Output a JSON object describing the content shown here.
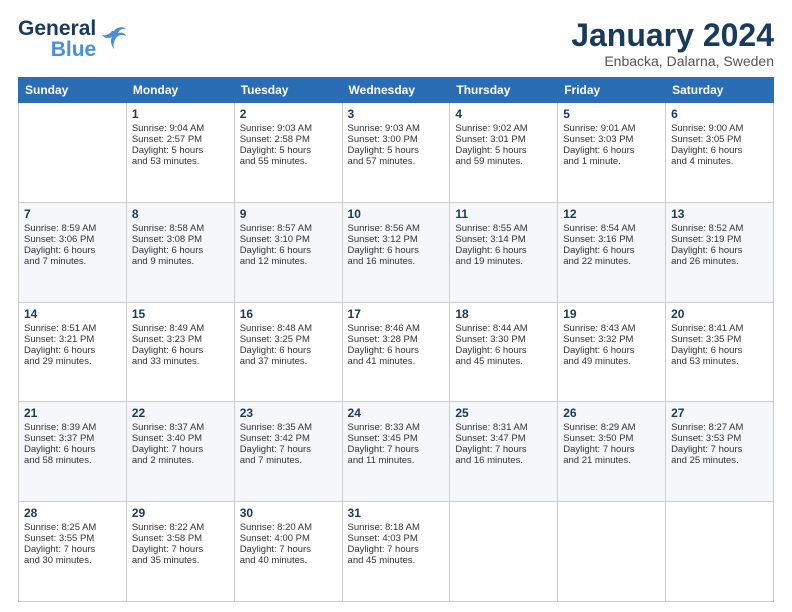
{
  "header": {
    "logo_line1": "General",
    "logo_line2": "Blue",
    "title": "January 2024",
    "subtitle": "Enbacka, Dalarna, Sweden"
  },
  "days_of_week": [
    "Sunday",
    "Monday",
    "Tuesday",
    "Wednesday",
    "Thursday",
    "Friday",
    "Saturday"
  ],
  "weeks": [
    [
      {
        "day": "",
        "info": ""
      },
      {
        "day": "1",
        "info": "Sunrise: 9:04 AM\nSunset: 2:57 PM\nDaylight: 5 hours\nand 53 minutes."
      },
      {
        "day": "2",
        "info": "Sunrise: 9:03 AM\nSunset: 2:58 PM\nDaylight: 5 hours\nand 55 minutes."
      },
      {
        "day": "3",
        "info": "Sunrise: 9:03 AM\nSunset: 3:00 PM\nDaylight: 5 hours\nand 57 minutes."
      },
      {
        "day": "4",
        "info": "Sunrise: 9:02 AM\nSunset: 3:01 PM\nDaylight: 5 hours\nand 59 minutes."
      },
      {
        "day": "5",
        "info": "Sunrise: 9:01 AM\nSunset: 3:03 PM\nDaylight: 6 hours\nand 1 minute."
      },
      {
        "day": "6",
        "info": "Sunrise: 9:00 AM\nSunset: 3:05 PM\nDaylight: 6 hours\nand 4 minutes."
      }
    ],
    [
      {
        "day": "7",
        "info": "Sunrise: 8:59 AM\nSunset: 3:06 PM\nDaylight: 6 hours\nand 7 minutes."
      },
      {
        "day": "8",
        "info": "Sunrise: 8:58 AM\nSunset: 3:08 PM\nDaylight: 6 hours\nand 9 minutes."
      },
      {
        "day": "9",
        "info": "Sunrise: 8:57 AM\nSunset: 3:10 PM\nDaylight: 6 hours\nand 12 minutes."
      },
      {
        "day": "10",
        "info": "Sunrise: 8:56 AM\nSunset: 3:12 PM\nDaylight: 6 hours\nand 16 minutes."
      },
      {
        "day": "11",
        "info": "Sunrise: 8:55 AM\nSunset: 3:14 PM\nDaylight: 6 hours\nand 19 minutes."
      },
      {
        "day": "12",
        "info": "Sunrise: 8:54 AM\nSunset: 3:16 PM\nDaylight: 6 hours\nand 22 minutes."
      },
      {
        "day": "13",
        "info": "Sunrise: 8:52 AM\nSunset: 3:19 PM\nDaylight: 6 hours\nand 26 minutes."
      }
    ],
    [
      {
        "day": "14",
        "info": "Sunrise: 8:51 AM\nSunset: 3:21 PM\nDaylight: 6 hours\nand 29 minutes."
      },
      {
        "day": "15",
        "info": "Sunrise: 8:49 AM\nSunset: 3:23 PM\nDaylight: 6 hours\nand 33 minutes."
      },
      {
        "day": "16",
        "info": "Sunrise: 8:48 AM\nSunset: 3:25 PM\nDaylight: 6 hours\nand 37 minutes."
      },
      {
        "day": "17",
        "info": "Sunrise: 8:46 AM\nSunset: 3:28 PM\nDaylight: 6 hours\nand 41 minutes."
      },
      {
        "day": "18",
        "info": "Sunrise: 8:44 AM\nSunset: 3:30 PM\nDaylight: 6 hours\nand 45 minutes."
      },
      {
        "day": "19",
        "info": "Sunrise: 8:43 AM\nSunset: 3:32 PM\nDaylight: 6 hours\nand 49 minutes."
      },
      {
        "day": "20",
        "info": "Sunrise: 8:41 AM\nSunset: 3:35 PM\nDaylight: 6 hours\nand 53 minutes."
      }
    ],
    [
      {
        "day": "21",
        "info": "Sunrise: 8:39 AM\nSunset: 3:37 PM\nDaylight: 6 hours\nand 58 minutes."
      },
      {
        "day": "22",
        "info": "Sunrise: 8:37 AM\nSunset: 3:40 PM\nDaylight: 7 hours\nand 2 minutes."
      },
      {
        "day": "23",
        "info": "Sunrise: 8:35 AM\nSunset: 3:42 PM\nDaylight: 7 hours\nand 7 minutes."
      },
      {
        "day": "24",
        "info": "Sunrise: 8:33 AM\nSunset: 3:45 PM\nDaylight: 7 hours\nand 11 minutes."
      },
      {
        "day": "25",
        "info": "Sunrise: 8:31 AM\nSunset: 3:47 PM\nDaylight: 7 hours\nand 16 minutes."
      },
      {
        "day": "26",
        "info": "Sunrise: 8:29 AM\nSunset: 3:50 PM\nDaylight: 7 hours\nand 21 minutes."
      },
      {
        "day": "27",
        "info": "Sunrise: 8:27 AM\nSunset: 3:53 PM\nDaylight: 7 hours\nand 25 minutes."
      }
    ],
    [
      {
        "day": "28",
        "info": "Sunrise: 8:25 AM\nSunset: 3:55 PM\nDaylight: 7 hours\nand 30 minutes."
      },
      {
        "day": "29",
        "info": "Sunrise: 8:22 AM\nSunset: 3:58 PM\nDaylight: 7 hours\nand 35 minutes."
      },
      {
        "day": "30",
        "info": "Sunrise: 8:20 AM\nSunset: 4:00 PM\nDaylight: 7 hours\nand 40 minutes."
      },
      {
        "day": "31",
        "info": "Sunrise: 8:18 AM\nSunset: 4:03 PM\nDaylight: 7 hours\nand 45 minutes."
      },
      {
        "day": "",
        "info": ""
      },
      {
        "day": "",
        "info": ""
      },
      {
        "day": "",
        "info": ""
      }
    ]
  ]
}
